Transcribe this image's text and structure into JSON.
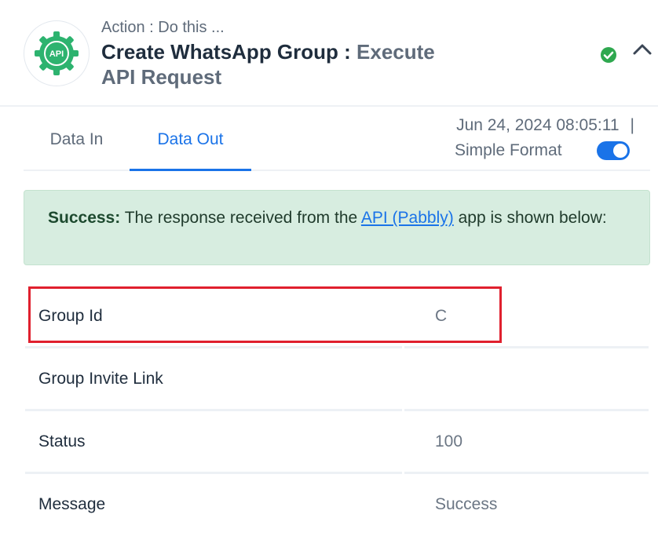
{
  "header": {
    "action_label": "Action : Do this ...",
    "title_main": "Create WhatsApp Group : ",
    "title_sub": "Execute API Request",
    "app_icon": "api-gear-icon",
    "app_icon_text": "API",
    "status_icon": "check-circle-icon",
    "collapse_icon": "chevron-up-icon"
  },
  "tabs": [
    {
      "label": "Data In",
      "active": false
    },
    {
      "label": "Data Out",
      "active": true
    }
  ],
  "meta": {
    "timestamp": "Jun 24, 2024 08:05:11",
    "separator": "|",
    "format_label": "Simple Format",
    "toggle_on": true
  },
  "alert": {
    "strong": "Success:",
    "before_link": " The response received from the ",
    "link": "API (Pabbly)",
    "after_link": " app is shown below:"
  },
  "rows": [
    {
      "label": "Group Id",
      "value": "C"
    },
    {
      "label": "Group Invite Link",
      "value": ""
    },
    {
      "label": "Status",
      "value": "100"
    },
    {
      "label": "Message",
      "value": "Success"
    }
  ],
  "colors": {
    "accent": "#1a73e8",
    "brand_green": "#2db36f",
    "success_bg": "#d7ede0",
    "highlight_red": "#e0202e"
  }
}
